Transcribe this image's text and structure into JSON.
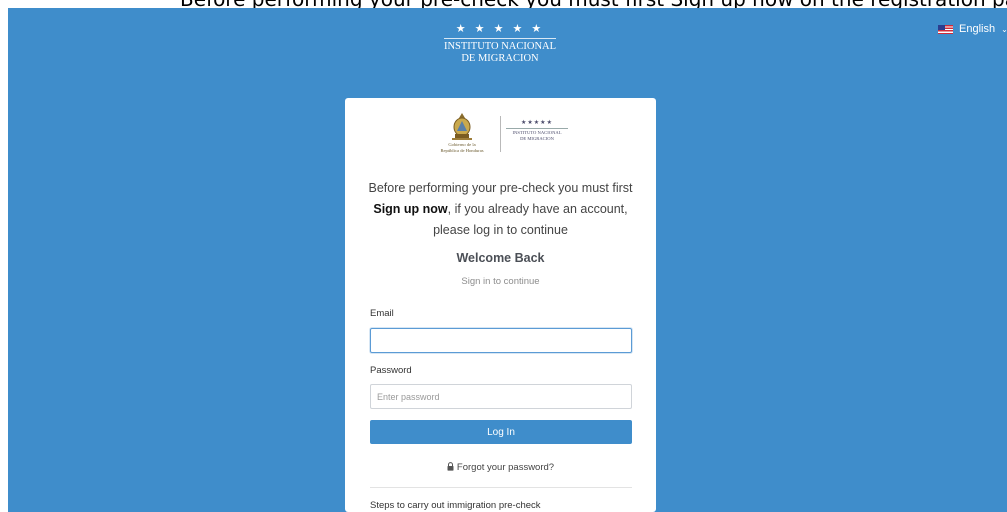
{
  "top_strip": {
    "text": "Before performing your pre-check you must first Sign up now on the registration page"
  },
  "header": {
    "logo": {
      "stars": "★ ★ ★ ★ ★",
      "line1": "INSTITUTO NACIONAL",
      "line2": "DE MIGRACION"
    },
    "language": {
      "label": "English",
      "flag": "us-flag-icon"
    }
  },
  "card": {
    "logo": {
      "gov_line1": "Gobierno de la",
      "gov_line2": "República de Honduras",
      "inm_stars": "★★★★★",
      "inm_line1": "INSTITUTO NACIONAL",
      "inm_line2": "DE MIGRACION"
    },
    "intro": {
      "part1": "Before performing your pre-check you must first ",
      "signup_link": "Sign up now",
      "part2": ", if you already have an account, please log in to continue"
    },
    "welcome": "Welcome Back",
    "subtitle": "Sign in to continue",
    "email": {
      "label": "Email",
      "value": "",
      "placeholder": ""
    },
    "password": {
      "label": "Password",
      "value": "",
      "placeholder": "Enter password"
    },
    "login_button": "Log In",
    "forgot_link": "Forgot your password?",
    "steps_heading": "Steps to carry out immigration pre-check"
  },
  "colors": {
    "background": "#3f8dcb",
    "button": "#3f8dcb",
    "card": "#ffffff"
  }
}
